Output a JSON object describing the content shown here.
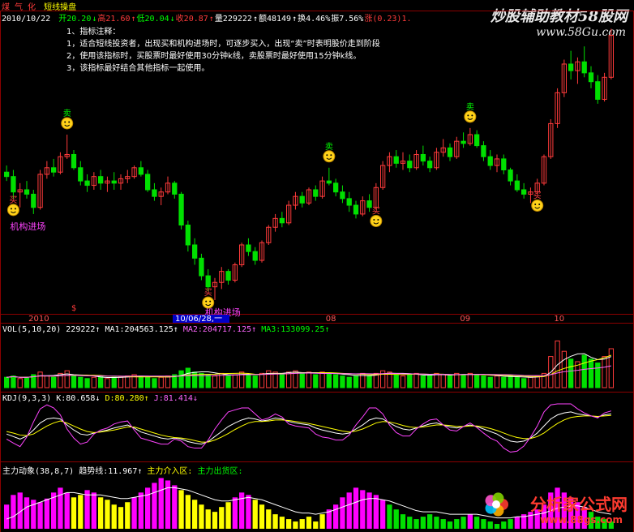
{
  "header": {
    "sector": "煤 气 化",
    "indicator_name": "短线操盘",
    "date": "2010/10/22",
    "items": [
      {
        "text": "开20.20",
        "color": "#00ff00"
      },
      {
        "text": "↓",
        "color": "#00ff00"
      },
      {
        "text": "高21.60",
        "color": "#ff3b3b"
      },
      {
        "text": "↑",
        "color": "#ff3b3b"
      },
      {
        "text": "低20.04",
        "color": "#00ff00"
      },
      {
        "text": "↓",
        "color": "#00ff00"
      },
      {
        "text": "收20.87",
        "color": "#ff3b3b"
      },
      {
        "text": "↑",
        "color": "#ff3b3b"
      },
      {
        "text": "量229222",
        "color": "#ffffff"
      },
      {
        "text": "↑",
        "color": "#ffffff"
      },
      {
        "text": "额48149",
        "color": "#ffffff"
      },
      {
        "text": "↑",
        "color": "#ffffff"
      },
      {
        "text": "换4.46%",
        "color": "#ffffff"
      },
      {
        "text": "振7.56%",
        "color": "#ffffff"
      },
      {
        "text": "涨(0.23)1.",
        "color": "#ff3b3b"
      }
    ]
  },
  "notes": [
    "1、指标注释：",
    "1，适合短线投资者，出现买和机构进场时，可逐步买入，出现“卖”时表明股价走到阶段",
    "2，使用该指标时，买股票时最好使用30分钟k线，卖股票时最好使用15分钟k线。",
    "3，该指标最好结合其他指标一起使用。"
  ],
  "watermarks": {
    "top_title": "炒股辅助教材58股网",
    "top_url": "www.58Gu.com",
    "bottom_title": "分析家公式网",
    "bottom_url": "www.88gs.com"
  },
  "signals": {
    "buy_label": "买",
    "sell_label": "卖",
    "institution_label": "机构进场",
    "institution_label_2": "机构进场"
  },
  "time_axis": {
    "labels": [
      "2010",
      "08",
      "08",
      "09",
      "10"
    ],
    "cursor_date": "10/06/28,一",
    "cursor_flag": "$"
  },
  "vol_panel": {
    "label": "VOL(5,10,20)",
    "value": "229222",
    "ma1": "MA1:204563.125",
    "ma2": "MA2:204717.125",
    "ma3": "MA3:133099.25",
    "arrow_up": "↑"
  },
  "kdj_panel": {
    "label": "KDJ(9,3,3)",
    "k": "K:80.658",
    "d": "D:80.280",
    "j": "J:81.414",
    "arrow_down": "↓",
    "arrow_up": "↑"
  },
  "main_panel": {
    "label": "主力动象(38,8,7)",
    "trend": "趋势线:11.967",
    "enter": "主力介入区:",
    "exit": "主力出货区:",
    "arrow_up": "↑"
  },
  "colors": {
    "up": "#ff3b3b",
    "down": "#00e000",
    "bg": "#000000",
    "grid": "#8b0000",
    "magenta": "#ff00ff",
    "yellow": "#ffff00",
    "white": "#ffffff"
  },
  "chart_data": [
    {
      "type": "candlestick",
      "title": "短线操盘",
      "x_labels": [
        "2010",
        "08",
        "08",
        "09",
        "10"
      ],
      "ohlc": [
        [
          18.8,
          19.1,
          18.4,
          18.6
        ],
        [
          18.6,
          18.9,
          17.6,
          17.9
        ],
        [
          17.9,
          18.3,
          17.2,
          18.0
        ],
        [
          18.0,
          18.4,
          17.6,
          17.8
        ],
        [
          17.8,
          18.0,
          16.9,
          17.2
        ],
        [
          17.2,
          18.9,
          17.1,
          18.7
        ],
        [
          18.7,
          19.3,
          18.5,
          19.0
        ],
        [
          19.0,
          19.4,
          18.6,
          18.8
        ],
        [
          18.8,
          19.7,
          18.7,
          19.5
        ],
        [
          19.5,
          20.5,
          19.4,
          19.6
        ],
        [
          19.6,
          19.8,
          18.9,
          19.0
        ],
        [
          19.0,
          19.3,
          18.2,
          18.4
        ],
        [
          18.4,
          18.7,
          17.9,
          18.2
        ],
        [
          18.2,
          18.8,
          18.0,
          18.6
        ],
        [
          18.6,
          18.9,
          18.0,
          18.3
        ],
        [
          18.3,
          18.6,
          17.9,
          18.4
        ],
        [
          18.4,
          18.8,
          18.0,
          18.3
        ],
        [
          18.3,
          18.7,
          18.0,
          18.5
        ],
        [
          18.5,
          18.9,
          18.3,
          18.6
        ],
        [
          18.6,
          19.1,
          18.5,
          19.0
        ],
        [
          19.0,
          19.3,
          18.6,
          18.7
        ],
        [
          18.7,
          18.9,
          17.9,
          18.0
        ],
        [
          18.0,
          18.3,
          17.5,
          17.7
        ],
        [
          17.7,
          18.1,
          17.3,
          17.9
        ],
        [
          17.9,
          18.6,
          17.8,
          18.3
        ],
        [
          18.3,
          18.4,
          17.6,
          17.8
        ],
        [
          17.8,
          17.9,
          16.2,
          16.4
        ],
        [
          16.4,
          16.6,
          15.2,
          15.5
        ],
        [
          15.5,
          15.8,
          14.6,
          14.9
        ],
        [
          14.9,
          15.1,
          13.9,
          14.1
        ],
        [
          14.1,
          14.4,
          13.4,
          13.6
        ],
        [
          13.6,
          14.0,
          13.0,
          13.8
        ],
        [
          13.8,
          14.5,
          13.5,
          14.3
        ],
        [
          14.3,
          14.4,
          13.7,
          13.9
        ],
        [
          13.9,
          14.7,
          13.8,
          14.6
        ],
        [
          14.6,
          15.6,
          14.5,
          15.5
        ],
        [
          15.5,
          15.8,
          15.0,
          15.2
        ],
        [
          15.2,
          15.4,
          14.6,
          14.8
        ],
        [
          14.8,
          15.7,
          14.7,
          15.6
        ],
        [
          15.6,
          16.4,
          15.5,
          16.3
        ],
        [
          16.3,
          16.9,
          16.1,
          16.7
        ],
        [
          16.7,
          17.0,
          16.3,
          16.5
        ],
        [
          16.5,
          17.5,
          16.4,
          17.3
        ],
        [
          17.3,
          17.9,
          17.1,
          17.7
        ],
        [
          17.7,
          17.9,
          17.2,
          17.4
        ],
        [
          17.4,
          18.1,
          17.3,
          18.0
        ],
        [
          18.0,
          18.2,
          17.5,
          17.7
        ],
        [
          17.7,
          18.6,
          17.6,
          18.4
        ],
        [
          18.4,
          19.0,
          18.2,
          18.3
        ],
        [
          18.3,
          18.5,
          17.7,
          17.9
        ],
        [
          17.9,
          18.2,
          17.4,
          17.6
        ],
        [
          17.6,
          17.9,
          17.0,
          17.3
        ],
        [
          17.3,
          17.5,
          16.7,
          16.9
        ],
        [
          16.9,
          17.7,
          16.8,
          17.5
        ],
        [
          17.5,
          17.8,
          17.0,
          17.2
        ],
        [
          17.2,
          18.3,
          17.1,
          18.1
        ],
        [
          18.1,
          19.3,
          18.0,
          19.1
        ],
        [
          19.1,
          19.7,
          18.8,
          19.5
        ],
        [
          19.5,
          19.8,
          19.0,
          19.2
        ],
        [
          19.2,
          19.7,
          18.9,
          19.3
        ],
        [
          19.3,
          19.6,
          18.8,
          19.0
        ],
        [
          19.0,
          19.8,
          18.9,
          19.6
        ],
        [
          19.6,
          20.0,
          19.1,
          19.3
        ],
        [
          19.3,
          19.5,
          18.8,
          19.0
        ],
        [
          19.0,
          19.9,
          18.9,
          19.7
        ],
        [
          19.7,
          20.3,
          19.5,
          19.9
        ],
        [
          19.9,
          20.1,
          19.3,
          19.5
        ],
        [
          19.5,
          20.4,
          19.4,
          20.2
        ],
        [
          20.2,
          20.6,
          19.9,
          20.1
        ],
        [
          20.1,
          20.8,
          20.0,
          20.5
        ],
        [
          20.5,
          20.7,
          19.9,
          20.0
        ],
        [
          20.0,
          20.2,
          19.3,
          19.5
        ],
        [
          19.5,
          19.8,
          18.9,
          19.1
        ],
        [
          19.1,
          19.6,
          18.8,
          19.4
        ],
        [
          19.4,
          19.6,
          18.7,
          18.9
        ],
        [
          18.9,
          19.0,
          18.2,
          18.4
        ],
        [
          18.4,
          18.7,
          17.9,
          18.0
        ],
        [
          18.0,
          18.3,
          17.6,
          17.8
        ],
        [
          17.8,
          18.1,
          17.4,
          17.9
        ],
        [
          17.9,
          18.5,
          17.8,
          18.3
        ],
        [
          18.3,
          19.6,
          18.2,
          19.5
        ],
        [
          19.5,
          21.2,
          19.4,
          21.0
        ],
        [
          21.0,
          22.6,
          20.8,
          22.4
        ],
        [
          22.4,
          23.9,
          22.2,
          23.7
        ],
        [
          23.7,
          24.3,
          23.0,
          23.4
        ],
        [
          23.4,
          24.0,
          22.8,
          23.8
        ],
        [
          23.8,
          24.5,
          23.1,
          23.3
        ],
        [
          23.3,
          23.6,
          22.6,
          22.9
        ],
        [
          22.9,
          23.2,
          21.9,
          22.1
        ],
        [
          22.1,
          23.3,
          22.0,
          23.1
        ],
        [
          23.1,
          25.3,
          23.0,
          25.0
        ]
      ],
      "signals": [
        {
          "bar": 1,
          "kind": "buy"
        },
        {
          "bar": 9,
          "kind": "sell"
        },
        {
          "bar": 30,
          "kind": "buy"
        },
        {
          "bar": 48,
          "kind": "sell"
        },
        {
          "bar": 55,
          "kind": "buy"
        },
        {
          "bar": 69,
          "kind": "sell"
        },
        {
          "bar": 79,
          "kind": "buy"
        }
      ],
      "ylim": [
        13.0,
        25.5
      ]
    },
    {
      "type": "bar",
      "title": "VOL(5,10,20)",
      "values": [
        8,
        9,
        7,
        8,
        10,
        12,
        9,
        8,
        11,
        13,
        9,
        8,
        7,
        8,
        9,
        7,
        8,
        8,
        9,
        10,
        9,
        8,
        7,
        8,
        9,
        10,
        13,
        15,
        12,
        11,
        10,
        9,
        11,
        9,
        10,
        12,
        10,
        9,
        11,
        13,
        12,
        10,
        12,
        13,
        11,
        12,
        10,
        12,
        11,
        10,
        9,
        8,
        9,
        11,
        9,
        11,
        13,
        12,
        10,
        9,
        10,
        11,
        9,
        9,
        11,
        10,
        9,
        11,
        10,
        11,
        10,
        9,
        8,
        9,
        8,
        9,
        8,
        7,
        8,
        9,
        11,
        24,
        36,
        28,
        22,
        20,
        25,
        22,
        19,
        24,
        30
      ],
      "up_down": "follows_price",
      "ylim": [
        0,
        40
      ]
    },
    {
      "type": "line",
      "title": "KDJ(9,3,3)",
      "series": [
        {
          "name": "K",
          "values": [
            40,
            35,
            30,
            36,
            48,
            62,
            70,
            72,
            70,
            58,
            48,
            40,
            38,
            42,
            45,
            48,
            52,
            55,
            58,
            52,
            44,
            40,
            36,
            32,
            30,
            32,
            30,
            25,
            22,
            20,
            25,
            35,
            45,
            55,
            62,
            68,
            72,
            70,
            66,
            68,
            72,
            70,
            65,
            62,
            60,
            58,
            52,
            48,
            45,
            42,
            40,
            42,
            50,
            58,
            68,
            72,
            70,
            62,
            55,
            50,
            48,
            52,
            56,
            60,
            62,
            58,
            54,
            52,
            55,
            58,
            55,
            50,
            45,
            40,
            32,
            26,
            24,
            26,
            32,
            42,
            56,
            70,
            78,
            82,
            84,
            80,
            78,
            76,
            74,
            78,
            80
          ]
        },
        {
          "name": "D",
          "values": [
            45,
            42,
            38,
            37,
            40,
            48,
            56,
            62,
            66,
            62,
            56,
            50,
            45,
            43,
            44,
            46,
            48,
            51,
            54,
            54,
            50,
            46,
            42,
            38,
            35,
            33,
            32,
            30,
            27,
            24,
            24,
            28,
            34,
            41,
            49,
            56,
            62,
            65,
            65,
            66,
            68,
            68,
            67,
            65,
            63,
            61,
            58,
            55,
            52,
            49,
            46,
            44,
            46,
            50,
            56,
            62,
            65,
            64,
            61,
            57,
            54,
            53,
            54,
            56,
            58,
            58,
            57,
            55,
            55,
            56,
            56,
            54,
            51,
            47,
            42,
            37,
            33,
            31,
            31,
            35,
            42,
            52,
            61,
            68,
            73,
            75,
            76,
            76,
            75,
            76,
            77
          ]
        },
        {
          "name": "J",
          "values": [
            30,
            22,
            15,
            34,
            64,
            90,
            98,
            92,
            78,
            50,
            32,
            20,
            24,
            40,
            48,
            52,
            60,
            64,
            66,
            48,
            32,
            28,
            24,
            20,
            20,
            30,
            26,
            15,
            12,
            12,
            28,
            50,
            68,
            84,
            88,
            92,
            92,
            80,
            68,
            72,
            80,
            74,
            60,
            56,
            54,
            52,
            40,
            34,
            32,
            28,
            28,
            38,
            58,
            74,
            92,
            92,
            80,
            58,
            43,
            36,
            36,
            50,
            60,
            68,
            70,
            58,
            48,
            46,
            55,
            62,
            53,
            42,
            32,
            26,
            12,
            4,
            6,
            16,
            34,
            56,
            84,
            98,
            100,
            100,
            100,
            90,
            82,
            76,
            72,
            82,
            86
          ]
        }
      ],
      "ylim": [
        0,
        100
      ]
    },
    {
      "type": "bar",
      "title": "主力动象(38,8,7)",
      "values": [
        20,
        28,
        30,
        26,
        24,
        22,
        25,
        30,
        34,
        30,
        26,
        28,
        32,
        30,
        26,
        24,
        20,
        18,
        22,
        26,
        30,
        34,
        38,
        42,
        40,
        36,
        32,
        28,
        24,
        20,
        16,
        14,
        18,
        22,
        26,
        30,
        28,
        24,
        20,
        16,
        12,
        10,
        8,
        6,
        8,
        10,
        6,
        12,
        16,
        20,
        26,
        30,
        34,
        32,
        30,
        28,
        24,
        20,
        16,
        12,
        10,
        8,
        10,
        12,
        10,
        8,
        6,
        8,
        10,
        12,
        10,
        8,
        6,
        4,
        6,
        8,
        10,
        12,
        14,
        16,
        20,
        30,
        34,
        30,
        26,
        22,
        18,
        14,
        10,
        8,
        6
      ],
      "trend_values": [
        8,
        10,
        14,
        18,
        20,
        22,
        24,
        26,
        28,
        30,
        30,
        29,
        28,
        28,
        28,
        27,
        26,
        25,
        25,
        26,
        27,
        28,
        30,
        32,
        34,
        34,
        33,
        32,
        30,
        28,
        26,
        24,
        23,
        23,
        24,
        25,
        26,
        25,
        24,
        22,
        20,
        18,
        16,
        14,
        13,
        13,
        12,
        13,
        14,
        16,
        18,
        20,
        22,
        24,
        25,
        25,
        24,
        23,
        21,
        19,
        17,
        15,
        14,
        14,
        14,
        13,
        12,
        12,
        12,
        12,
        12,
        11,
        10,
        9,
        9,
        9,
        10,
        10,
        11,
        12,
        13,
        15,
        17,
        18,
        19,
        19,
        18,
        16,
        14,
        13,
        12
      ],
      "ylim": [
        0,
        45
      ]
    }
  ]
}
